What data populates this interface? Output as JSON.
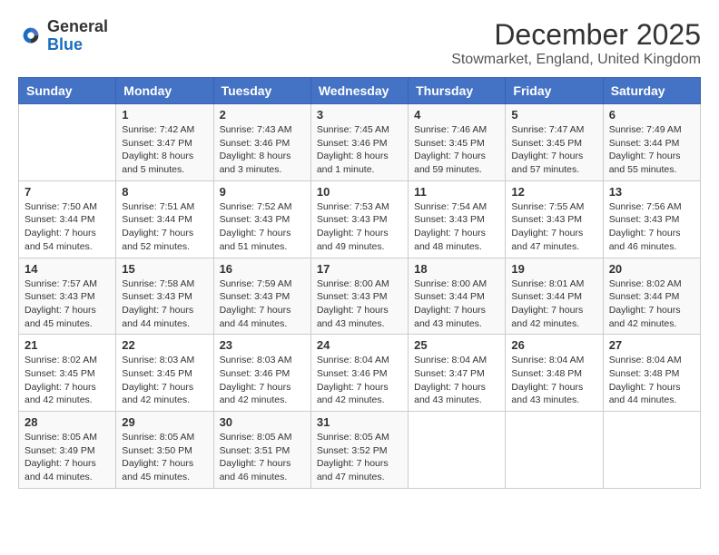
{
  "header": {
    "logo": {
      "general": "General",
      "blue": "Blue"
    },
    "title": "December 2025",
    "location": "Stowmarket, England, United Kingdom"
  },
  "calendar": {
    "weekdays": [
      "Sunday",
      "Monday",
      "Tuesday",
      "Wednesday",
      "Thursday",
      "Friday",
      "Saturday"
    ],
    "weeks": [
      [
        {
          "day": "",
          "sunrise": "",
          "sunset": "",
          "daylight": ""
        },
        {
          "day": "1",
          "sunrise": "Sunrise: 7:42 AM",
          "sunset": "Sunset: 3:47 PM",
          "daylight": "Daylight: 8 hours and 5 minutes."
        },
        {
          "day": "2",
          "sunrise": "Sunrise: 7:43 AM",
          "sunset": "Sunset: 3:46 PM",
          "daylight": "Daylight: 8 hours and 3 minutes."
        },
        {
          "day": "3",
          "sunrise": "Sunrise: 7:45 AM",
          "sunset": "Sunset: 3:46 PM",
          "daylight": "Daylight: 8 hours and 1 minute."
        },
        {
          "day": "4",
          "sunrise": "Sunrise: 7:46 AM",
          "sunset": "Sunset: 3:45 PM",
          "daylight": "Daylight: 7 hours and 59 minutes."
        },
        {
          "day": "5",
          "sunrise": "Sunrise: 7:47 AM",
          "sunset": "Sunset: 3:45 PM",
          "daylight": "Daylight: 7 hours and 57 minutes."
        },
        {
          "day": "6",
          "sunrise": "Sunrise: 7:49 AM",
          "sunset": "Sunset: 3:44 PM",
          "daylight": "Daylight: 7 hours and 55 minutes."
        }
      ],
      [
        {
          "day": "7",
          "sunrise": "Sunrise: 7:50 AM",
          "sunset": "Sunset: 3:44 PM",
          "daylight": "Daylight: 7 hours and 54 minutes."
        },
        {
          "day": "8",
          "sunrise": "Sunrise: 7:51 AM",
          "sunset": "Sunset: 3:44 PM",
          "daylight": "Daylight: 7 hours and 52 minutes."
        },
        {
          "day": "9",
          "sunrise": "Sunrise: 7:52 AM",
          "sunset": "Sunset: 3:43 PM",
          "daylight": "Daylight: 7 hours and 51 minutes."
        },
        {
          "day": "10",
          "sunrise": "Sunrise: 7:53 AM",
          "sunset": "Sunset: 3:43 PM",
          "daylight": "Daylight: 7 hours and 49 minutes."
        },
        {
          "day": "11",
          "sunrise": "Sunrise: 7:54 AM",
          "sunset": "Sunset: 3:43 PM",
          "daylight": "Daylight: 7 hours and 48 minutes."
        },
        {
          "day": "12",
          "sunrise": "Sunrise: 7:55 AM",
          "sunset": "Sunset: 3:43 PM",
          "daylight": "Daylight: 7 hours and 47 minutes."
        },
        {
          "day": "13",
          "sunrise": "Sunrise: 7:56 AM",
          "sunset": "Sunset: 3:43 PM",
          "daylight": "Daylight: 7 hours and 46 minutes."
        }
      ],
      [
        {
          "day": "14",
          "sunrise": "Sunrise: 7:57 AM",
          "sunset": "Sunset: 3:43 PM",
          "daylight": "Daylight: 7 hours and 45 minutes."
        },
        {
          "day": "15",
          "sunrise": "Sunrise: 7:58 AM",
          "sunset": "Sunset: 3:43 PM",
          "daylight": "Daylight: 7 hours and 44 minutes."
        },
        {
          "day": "16",
          "sunrise": "Sunrise: 7:59 AM",
          "sunset": "Sunset: 3:43 PM",
          "daylight": "Daylight: 7 hours and 44 minutes."
        },
        {
          "day": "17",
          "sunrise": "Sunrise: 8:00 AM",
          "sunset": "Sunset: 3:43 PM",
          "daylight": "Daylight: 7 hours and 43 minutes."
        },
        {
          "day": "18",
          "sunrise": "Sunrise: 8:00 AM",
          "sunset": "Sunset: 3:44 PM",
          "daylight": "Daylight: 7 hours and 43 minutes."
        },
        {
          "day": "19",
          "sunrise": "Sunrise: 8:01 AM",
          "sunset": "Sunset: 3:44 PM",
          "daylight": "Daylight: 7 hours and 42 minutes."
        },
        {
          "day": "20",
          "sunrise": "Sunrise: 8:02 AM",
          "sunset": "Sunset: 3:44 PM",
          "daylight": "Daylight: 7 hours and 42 minutes."
        }
      ],
      [
        {
          "day": "21",
          "sunrise": "Sunrise: 8:02 AM",
          "sunset": "Sunset: 3:45 PM",
          "daylight": "Daylight: 7 hours and 42 minutes."
        },
        {
          "day": "22",
          "sunrise": "Sunrise: 8:03 AM",
          "sunset": "Sunset: 3:45 PM",
          "daylight": "Daylight: 7 hours and 42 minutes."
        },
        {
          "day": "23",
          "sunrise": "Sunrise: 8:03 AM",
          "sunset": "Sunset: 3:46 PM",
          "daylight": "Daylight: 7 hours and 42 minutes."
        },
        {
          "day": "24",
          "sunrise": "Sunrise: 8:04 AM",
          "sunset": "Sunset: 3:46 PM",
          "daylight": "Daylight: 7 hours and 42 minutes."
        },
        {
          "day": "25",
          "sunrise": "Sunrise: 8:04 AM",
          "sunset": "Sunset: 3:47 PM",
          "daylight": "Daylight: 7 hours and 43 minutes."
        },
        {
          "day": "26",
          "sunrise": "Sunrise: 8:04 AM",
          "sunset": "Sunset: 3:48 PM",
          "daylight": "Daylight: 7 hours and 43 minutes."
        },
        {
          "day": "27",
          "sunrise": "Sunrise: 8:04 AM",
          "sunset": "Sunset: 3:48 PM",
          "daylight": "Daylight: 7 hours and 44 minutes."
        }
      ],
      [
        {
          "day": "28",
          "sunrise": "Sunrise: 8:05 AM",
          "sunset": "Sunset: 3:49 PM",
          "daylight": "Daylight: 7 hours and 44 minutes."
        },
        {
          "day": "29",
          "sunrise": "Sunrise: 8:05 AM",
          "sunset": "Sunset: 3:50 PM",
          "daylight": "Daylight: 7 hours and 45 minutes."
        },
        {
          "day": "30",
          "sunrise": "Sunrise: 8:05 AM",
          "sunset": "Sunset: 3:51 PM",
          "daylight": "Daylight: 7 hours and 46 minutes."
        },
        {
          "day": "31",
          "sunrise": "Sunrise: 8:05 AM",
          "sunset": "Sunset: 3:52 PM",
          "daylight": "Daylight: 7 hours and 47 minutes."
        },
        {
          "day": "",
          "sunrise": "",
          "sunset": "",
          "daylight": ""
        },
        {
          "day": "",
          "sunrise": "",
          "sunset": "",
          "daylight": ""
        },
        {
          "day": "",
          "sunrise": "",
          "sunset": "",
          "daylight": ""
        }
      ]
    ]
  }
}
